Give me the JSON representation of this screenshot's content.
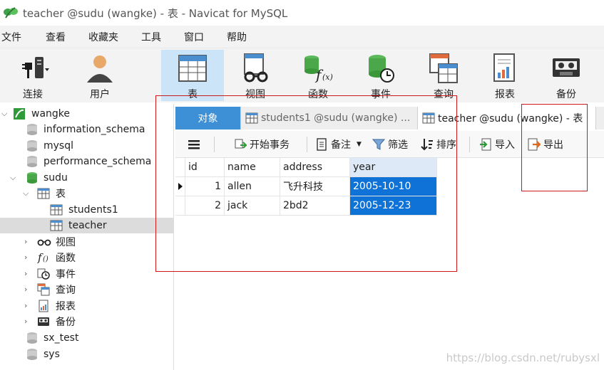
{
  "window": {
    "title": "teacher @sudu (wangke) - 表 - Navicat for MySQL"
  },
  "menu": [
    "文件",
    "查看",
    "收藏夹",
    "工具",
    "窗口",
    "帮助"
  ],
  "toolbar": {
    "connect": "连接",
    "user": "用户",
    "table": "表",
    "view": "视图",
    "function": "函数",
    "event": "事件",
    "query": "查询",
    "report": "报表",
    "backup": "备份"
  },
  "sidebar": {
    "connection": "wangke",
    "databases": [
      "information_schema",
      "mysql",
      "performance_schema"
    ],
    "sudu": "sudu",
    "tables_group": "表",
    "tables": [
      "students1",
      "teacher"
    ],
    "groups": [
      "视图",
      "函数",
      "事件",
      "查询",
      "报表",
      "备份"
    ],
    "other_dbs": [
      "sx_test",
      "sys"
    ]
  },
  "tabs": {
    "objects": "对象",
    "t1": "students1 @sudu (wangke) ...",
    "t2": "teacher @sudu (wangke) - 表"
  },
  "objbar": {
    "begin_tx": "开始事务",
    "note": "备注",
    "filter": "筛选",
    "sort": "排序",
    "import": "导入",
    "export": "导出"
  },
  "grid": {
    "columns": [
      "id",
      "name",
      "address",
      "year"
    ],
    "rows": [
      {
        "id": "1",
        "name": "allen",
        "address": "飞升科技",
        "year": "2005-10-10"
      },
      {
        "id": "2",
        "name": "jack",
        "address": "2bd2",
        "year": "2005-12-23"
      }
    ]
  },
  "watermark": "https://blog.csdn.net/rubysxl",
  "colors": {
    "accent": "#3d8fd6",
    "selection": "#0e72d6",
    "annotation": "#cc1a1a"
  }
}
